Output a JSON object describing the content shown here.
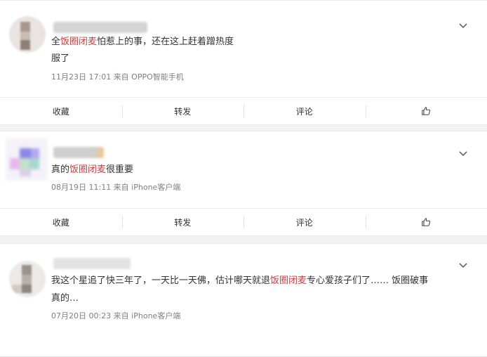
{
  "comments": [
    {
      "text_before": "全",
      "highlight": "饭圈闭麦",
      "text_after": "怕惹上的事，还在这上赶着蹭热度",
      "line2": "服了",
      "meta": "11月23日 17:01 来自 OPPO智能手机"
    },
    {
      "text_before": "真的",
      "highlight": "饭圈闭麦",
      "text_after": "很重要",
      "meta": "08月19日 11:11 来自 iPhone客户端"
    },
    {
      "text_before": "我这个星追了快三年了，一天比一天佛，估计哪天就退",
      "highlight": "饭圈闭麦",
      "text_after": "专心爱孩子们了…… 饭圈破事",
      "line2": "真的…",
      "meta": "07月20日 00:23 来自 iPhone客户端"
    }
  ],
  "actions": {
    "favorite": "收藏",
    "repost": "转发",
    "comment": "评论"
  },
  "icons": {
    "more": "chevron-down-icon",
    "like": "thumbs-up-icon"
  },
  "colors": {
    "highlight": "#d9383c",
    "meta": "#808080",
    "background": "#f2f2f5"
  }
}
